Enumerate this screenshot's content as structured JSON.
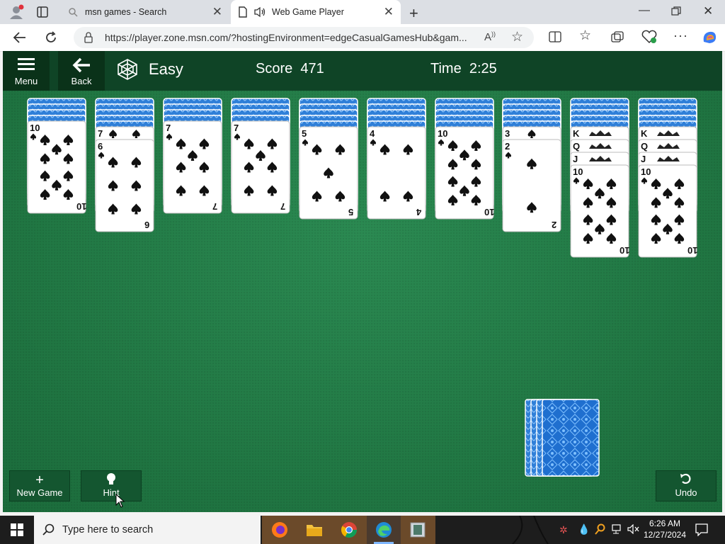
{
  "browser": {
    "tabs": [
      {
        "label": "msn games - Search",
        "active": false
      },
      {
        "label": "Web Game Player",
        "active": true
      }
    ],
    "url": "https://player.zone.msn.com/?hostingEnvironment=edgeCasualGamesHub&gam..."
  },
  "game": {
    "toolbar": {
      "menu_label": "Menu",
      "back_label": "Back"
    },
    "difficulty": "Easy",
    "score_label": "Score",
    "score": "471",
    "time_label": "Time",
    "time": "2:25",
    "columns": [
      {
        "hidden": 4,
        "cards": [
          "10"
        ]
      },
      {
        "hidden": 5,
        "cards": [
          "7",
          "6"
        ]
      },
      {
        "hidden": 4,
        "cards": [
          "7"
        ]
      },
      {
        "hidden": 4,
        "cards": [
          "7"
        ]
      },
      {
        "hidden": 5,
        "cards": [
          "5"
        ]
      },
      {
        "hidden": 5,
        "cards": [
          "4"
        ]
      },
      {
        "hidden": 5,
        "cards": [
          "10"
        ]
      },
      {
        "hidden": 5,
        "cards": [
          "3",
          "2"
        ]
      },
      {
        "hidden": 5,
        "cards": [
          "K",
          "Q",
          "J",
          "10"
        ]
      },
      {
        "hidden": 5,
        "cards": [
          "K",
          "Q",
          "J",
          "10"
        ]
      }
    ],
    "suit": "spades",
    "stock_deals_remaining": 4,
    "buttons": {
      "new_game": "New Game",
      "hint": "Hint",
      "undo": "Undo"
    }
  },
  "taskbar": {
    "search_placeholder": "Type here to search",
    "time": "6:26 AM",
    "date": "12/27/2024"
  }
}
